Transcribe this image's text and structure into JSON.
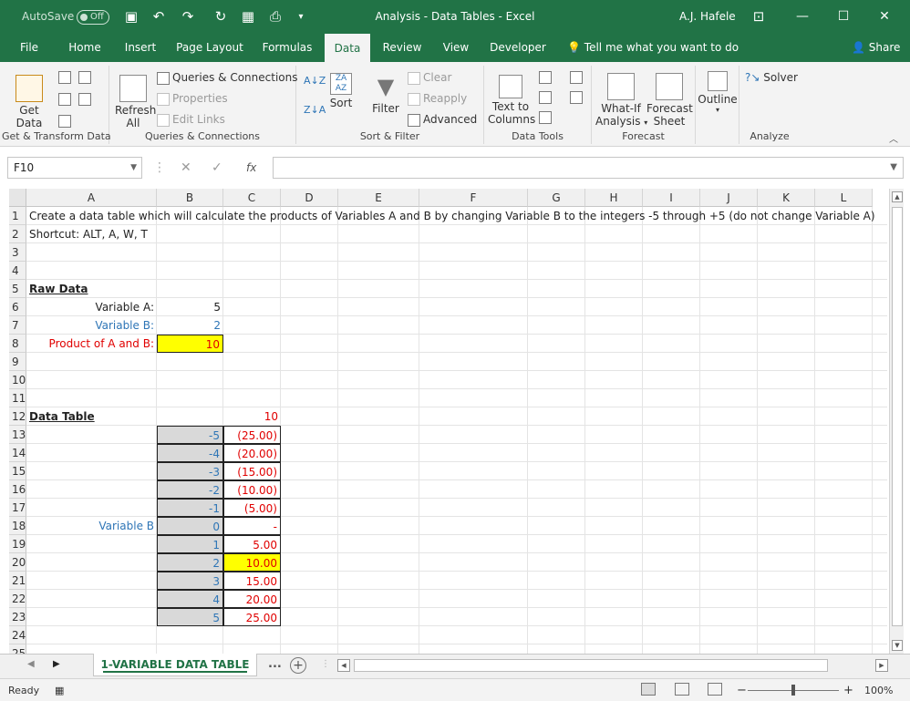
{
  "titlebar": {
    "autosave_label": "AutoSave",
    "autosave_state": "Off",
    "title": "Analysis - Data Tables  -  Excel",
    "user": "A.J. Hafele",
    "min": "—",
    "restore": "☐",
    "close": "✕"
  },
  "tabs": {
    "file": "File",
    "home": "Home",
    "insert": "Insert",
    "page_layout": "Page Layout",
    "formulas": "Formulas",
    "data": "Data",
    "review": "Review",
    "view": "View",
    "developer": "Developer",
    "tell_me": "Tell me what you want to do",
    "share": "Share"
  },
  "ribbon": {
    "get_data": "Get",
    "get_data2": "Data",
    "group_get_transform": "Get & Transform Data",
    "refresh": "Refresh",
    "refresh2": "All",
    "queries_connections": "Queries & Connections",
    "properties": "Properties",
    "edit_links": "Edit Links",
    "group_queries": "Queries & Connections",
    "sort": "Sort",
    "filter": "Filter",
    "clear": "Clear",
    "reapply": "Reapply",
    "advanced": "Advanced",
    "group_sort_filter": "Sort & Filter",
    "text_to": "Text to",
    "columns": "Columns",
    "group_data_tools": "Data Tools",
    "what_if": "What-If",
    "analysis": "Analysis",
    "forecast": "Forecast",
    "sheet": "Sheet",
    "group_forecast": "Forecast",
    "outline": "Outline",
    "solver": "Solver",
    "group_analyze": "Analyze"
  },
  "formula_bar": {
    "name_box": "F10",
    "fx": "fx",
    "formula": ""
  },
  "columns": [
    "A",
    "B",
    "C",
    "D",
    "E",
    "F",
    "G",
    "H",
    "I",
    "J",
    "K",
    "L"
  ],
  "rows": [
    "1",
    "2",
    "3",
    "4",
    "5",
    "6",
    "7",
    "8",
    "9",
    "10",
    "11",
    "12",
    "13",
    "14",
    "15",
    "16",
    "17",
    "18",
    "19",
    "20",
    "21",
    "22",
    "23",
    "24",
    "25"
  ],
  "cells": {
    "A1": "Create a data table which will calculate the products of Variables A and B by changing Variable B to the integers -5 through +5  (do not change Variable A)",
    "A2": "Shortcut: ALT, A, W, T",
    "A5": "Raw Data",
    "A6": "Variable A:",
    "B6": "5",
    "A7": "Variable B:",
    "B7": "2",
    "A8": "Product of A and B:",
    "B8": "10",
    "A12": "Data Table",
    "C12": "10",
    "A18": "Variable B"
  },
  "data_table": {
    "b_values": [
      "-5",
      "-4",
      "-3",
      "-2",
      "-1",
      "0",
      "1",
      "2",
      "3",
      "4",
      "5"
    ],
    "c_values": [
      "(25.00)",
      "(20.00)",
      "(15.00)",
      "(10.00)",
      "(5.00)",
      "-",
      "5.00",
      "10.00",
      "15.00",
      "20.00",
      "25.00"
    ],
    "highlight_index": 7
  },
  "sheet": {
    "tab_name": "1-VARIABLE DATA TABLE",
    "more": "...",
    "add": "+"
  },
  "status": {
    "ready": "Ready",
    "zoom": "100%",
    "zoom_minus": "−",
    "zoom_plus": "+"
  },
  "colors": {
    "excel_green": "#217346",
    "highlight_yellow": "#ffff00",
    "input_blue": "#2e75b6",
    "output_red": "#e00000",
    "table_gray": "#d9d9d9"
  }
}
